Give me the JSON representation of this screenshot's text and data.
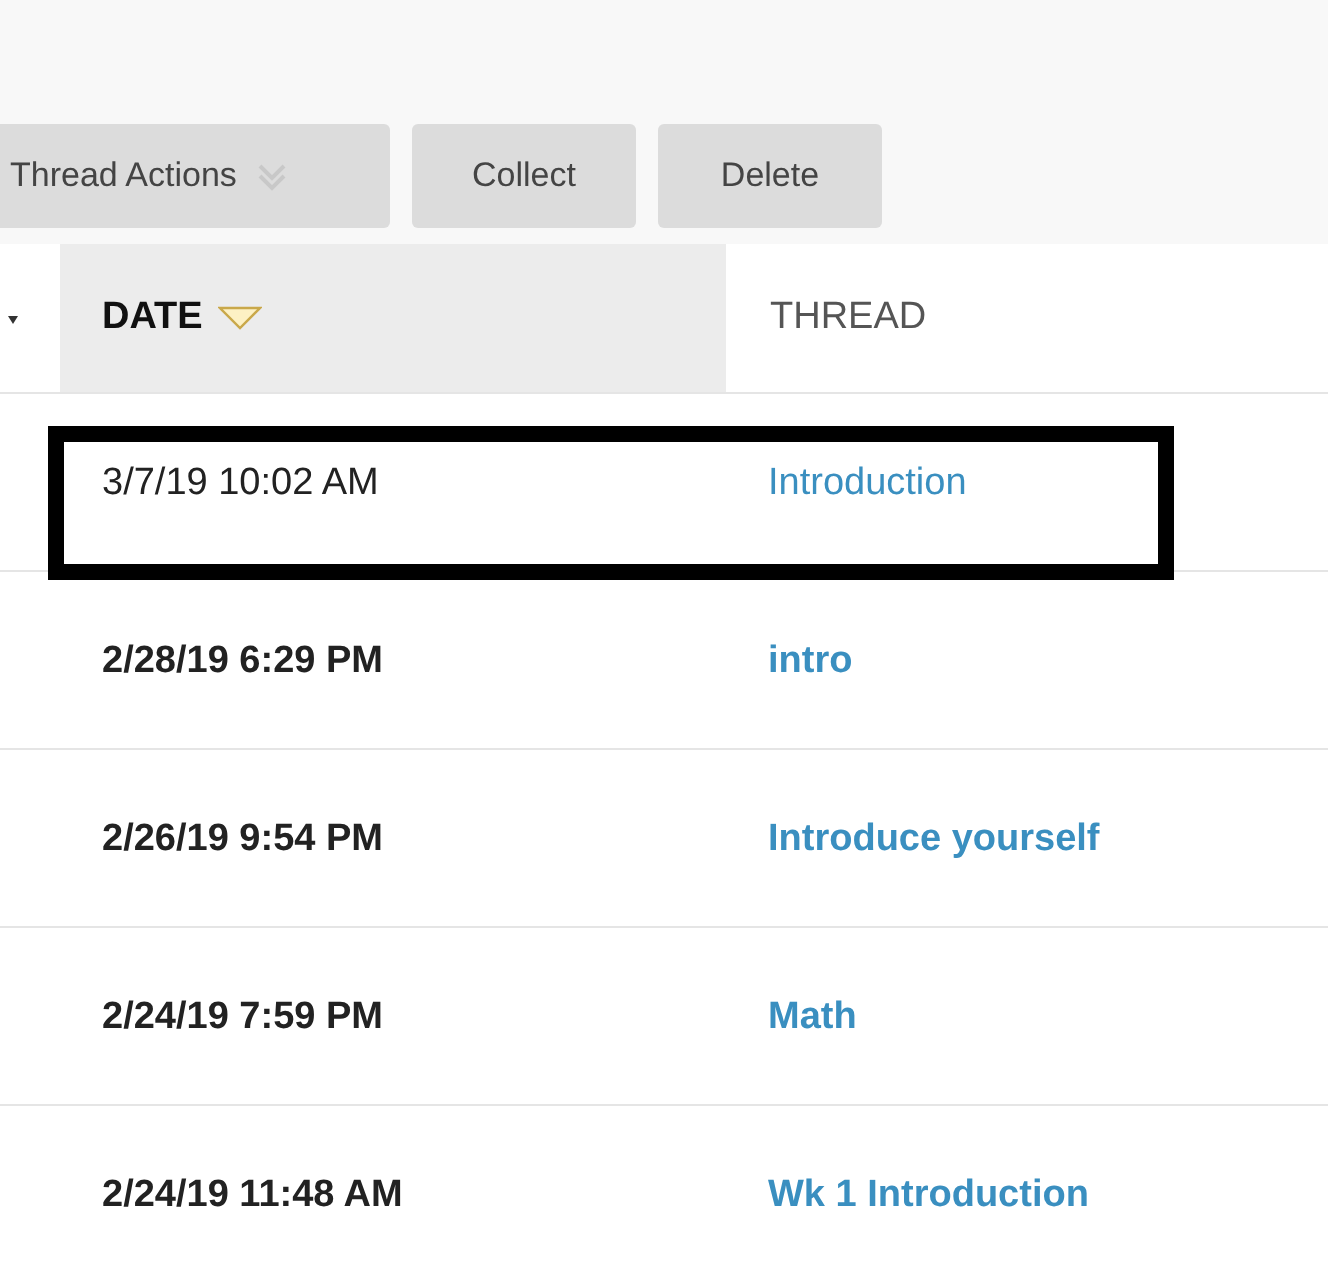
{
  "toolbar": {
    "buttons": [
      {
        "label": "Thread Actions",
        "kind": "menu"
      },
      {
        "label": "Collect",
        "kind": "plain"
      },
      {
        "label": "Delete",
        "kind": "plain"
      }
    ]
  },
  "table": {
    "columns": [
      {
        "label": "DATE",
        "sorted": true
      },
      {
        "label": "THREAD",
        "sorted": false
      }
    ],
    "rows": [
      {
        "date": "3/7/19 10:02 AM",
        "thread": "Introduction",
        "unread": false,
        "highlighted": true
      },
      {
        "date": "2/28/19 6:29 PM",
        "thread": "intro",
        "unread": true,
        "highlighted": false
      },
      {
        "date": "2/26/19 9:54 PM",
        "thread": "Introduce yourself",
        "unread": true,
        "highlighted": false
      },
      {
        "date": "2/24/19 7:59 PM",
        "thread": "Math",
        "unread": true,
        "highlighted": false
      },
      {
        "date": "2/24/19 11:48 AM",
        "thread": "Wk 1 Introduction",
        "unread": true,
        "highlighted": false
      }
    ]
  }
}
